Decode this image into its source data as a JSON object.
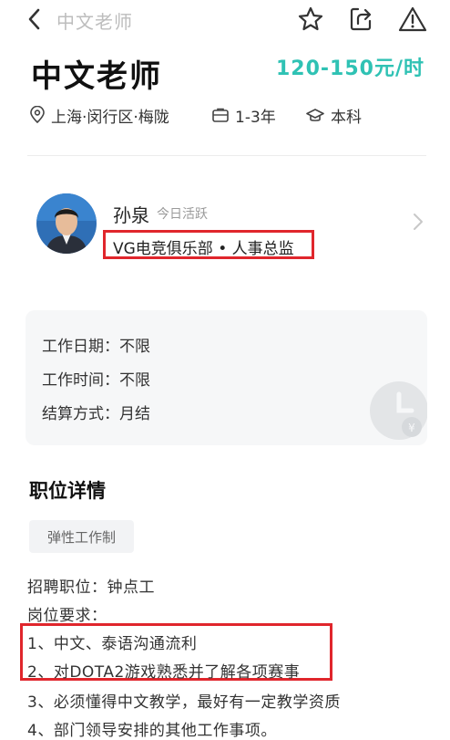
{
  "nav": {
    "title": "中文老师",
    "icons": [
      "back-icon",
      "star-icon",
      "share-icon",
      "report-icon"
    ]
  },
  "job": {
    "title": "中文老师",
    "salary": "120-150元/时",
    "location": "上海·闵行区·梅陇",
    "experience": "1-3年",
    "education": "本科"
  },
  "recruiter": {
    "name": "孙泉",
    "active": "今日活跃",
    "company_role": "VG电竞俱乐部 • 人事总监"
  },
  "info": {
    "rows": [
      {
        "label": "工作日期：",
        "value": "不限"
      },
      {
        "label": "工作时间：",
        "value": "不限"
      },
      {
        "label": "结算方式：",
        "value": "月结"
      }
    ]
  },
  "details": {
    "title": "职位详情",
    "tag": "弹性工作制",
    "lines": [
      "招聘职位：钟点工",
      "岗位要求：",
      "1、中文、泰语沟通流利",
      "2、对DOTA2游戏熟悉并了解各项赛事",
      "3、必须懂得中文教学，最好有一定教学资质",
      "4、部门领导安排的其他工作事项。"
    ]
  },
  "colors": {
    "accent": "#2fc2b4",
    "highlight": "#e0262c",
    "card_bg": "#f6f7f8"
  }
}
